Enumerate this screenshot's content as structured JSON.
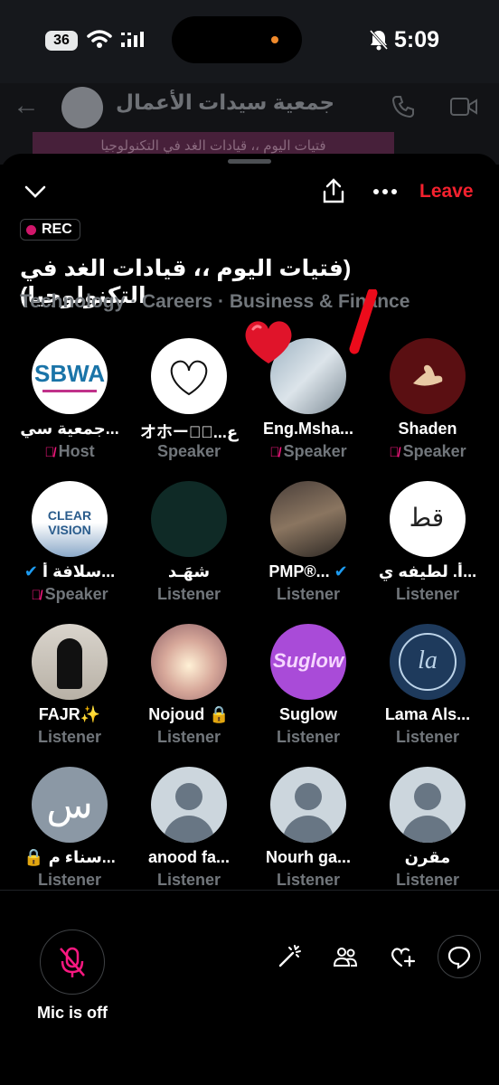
{
  "status_bar": {
    "battery": "36",
    "time": "5:09"
  },
  "background_chat": {
    "title": "جمعية سيدات الأعمال",
    "banner": "فتيات اليوم ،، قيادات الغد في التكنولوجيا"
  },
  "space": {
    "leave_label": "Leave",
    "rec_label": "REC",
    "title": "(فتيات اليوم ،، قيادات الغد في التكنولوجيا)",
    "topics": "Technology · Careers · Business & Finance",
    "participants": [
      {
        "name": "جمعية سي...",
        "role": "Host",
        "muted": true
      },
      {
        "name": "オホードُ...ع",
        "role": "Speaker",
        "muted": false
      },
      {
        "name": "Eng.Msha...",
        "role": "Speaker",
        "muted": true
      },
      {
        "name": "Shaden",
        "role": "Speaker",
        "muted": true
      },
      {
        "name": "سلافة أ...",
        "role": "Speaker",
        "muted": true,
        "verified": true
      },
      {
        "name": "شهَـد",
        "role": "Listener"
      },
      {
        "name": "PMP®...",
        "role": "Listener",
        "verified": true
      },
      {
        "name": "أ. لطيفه ي...",
        "role": "Listener"
      },
      {
        "name": "FAJR✨",
        "role": "Listener"
      },
      {
        "name": "Nojoud",
        "role": "Listener",
        "locked": true
      },
      {
        "name": "Suglow",
        "role": "Listener"
      },
      {
        "name": "Lama Als...",
        "role": "Listener"
      },
      {
        "name": "سناء م...",
        "role": "Listener",
        "locked": true
      },
      {
        "name": "anood fa...",
        "role": "Listener"
      },
      {
        "name": "Nourh ga...",
        "role": "Listener"
      },
      {
        "name": "مقرن",
        "role": "Listener"
      }
    ]
  },
  "avatars": {
    "sbwa_text": "SBWA",
    "clear_vision_text": "CLEAR VISION",
    "suglow_text": "Suglow",
    "la_text": "la",
    "sin_text": "س"
  },
  "footer": {
    "mic_label": "Mic is off"
  },
  "colors": {
    "accent_red": "#f4212e",
    "mute_pink": "#f91880",
    "muted_text": "#71767b",
    "verified_blue": "#1d9bf0"
  }
}
